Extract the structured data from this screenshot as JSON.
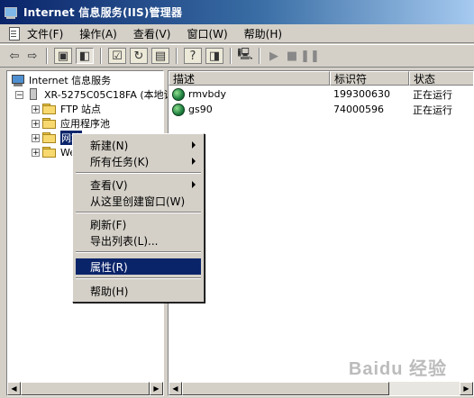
{
  "window": {
    "title": "Internet 信息服务(IIS)管理器"
  },
  "menubar": {
    "items": [
      {
        "label": "文件(F)"
      },
      {
        "label": "操作(A)"
      },
      {
        "label": "查看(V)"
      },
      {
        "label": "窗口(W)"
      },
      {
        "label": "帮助(H)"
      }
    ]
  },
  "toolbar": {
    "icons": [
      "back-arrow-icon",
      "forward-arrow-icon",
      "up-folder-icon",
      "show-tree-icon",
      "properties-icon",
      "refresh-icon",
      "export-icon",
      "help-icon",
      "show-scope-icon",
      "connect-icon",
      "play-icon",
      "stop-icon",
      "pause-icon"
    ]
  },
  "tree": {
    "root": "Internet 信息服务",
    "server": "XR-5275C05C18FA (本地计",
    "children": [
      {
        "label": "FTP 站点"
      },
      {
        "label": "应用程序池"
      },
      {
        "label": "网站"
      },
      {
        "label": "We"
      }
    ]
  },
  "listview": {
    "columns": [
      "描述",
      "标识符",
      "状态"
    ],
    "rows": [
      {
        "name": "rmvbdy",
        "id": "199300630",
        "status": "正在运行"
      },
      {
        "name": "gs90",
        "id": "74000596",
        "status": "正在运行"
      }
    ]
  },
  "context_menu": {
    "items": [
      {
        "label": "新建(N)",
        "submenu": true
      },
      {
        "label": "所有任务(K)",
        "submenu": true
      },
      {
        "label": "查看(V)",
        "submenu": true
      },
      {
        "label": "从这里创建窗口(W)",
        "submenu": false
      },
      {
        "label": "刷新(F)",
        "submenu": false
      },
      {
        "label": "导出列表(L)...",
        "submenu": false
      },
      {
        "label": "属性(R)",
        "submenu": false,
        "highlighted": true
      },
      {
        "label": "帮助(H)",
        "submenu": false
      }
    ]
  },
  "watermark": "Baidu 经验"
}
